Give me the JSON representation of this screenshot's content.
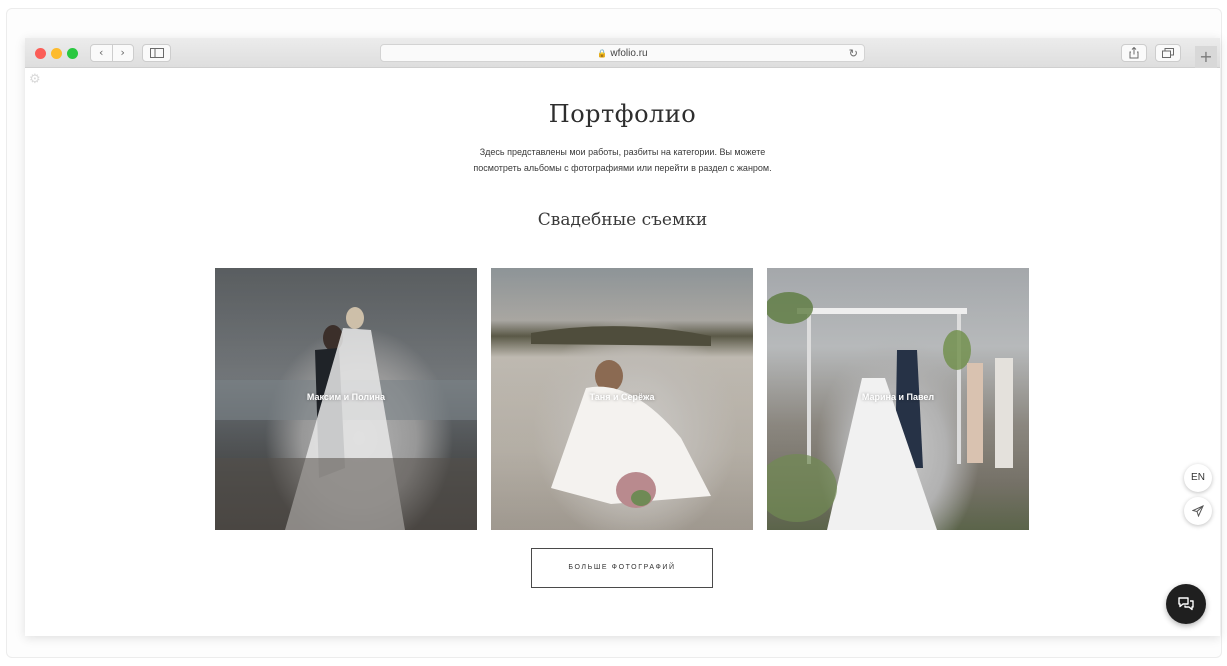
{
  "browser": {
    "url": "wfolio.ru",
    "nav_back": "‹",
    "nav_forward": "›",
    "new_tab": "+"
  },
  "page": {
    "title": "Портфолио",
    "description_line1": "Здесь представлены мои работы, разбиты на категории. Вы можете",
    "description_line2": "посмотреть альбомы с фотографиями или перейти в раздел с жанром."
  },
  "section": {
    "title": "Свадебные съемки",
    "albums": [
      {
        "label": "Максим и Полина"
      },
      {
        "label": "Таня и Серёжа"
      },
      {
        "label": "Марина и Павел"
      }
    ],
    "more_button": "БОЛЬШЕ ФОТОГРАФИЙ"
  },
  "widgets": {
    "language": "EN",
    "share_icon": "paper-plane-icon",
    "chat_icon": "chat-bubbles-icon"
  },
  "colors": {
    "traffic_red": "#fb5d57",
    "traffic_yellow": "#fdbb2e",
    "traffic_green": "#29c840",
    "chat_button": "#1f1f1f"
  }
}
